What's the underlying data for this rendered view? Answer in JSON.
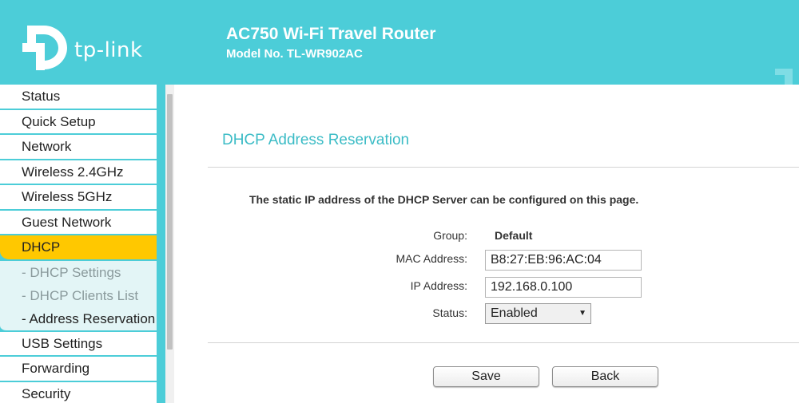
{
  "header": {
    "logo_text": "tp-link",
    "product_title": "AC750 Wi-Fi Travel Router",
    "model_no": "Model No. TL-WR902AC",
    "background": "#4ccdd8"
  },
  "sidebar": {
    "items_before": [
      {
        "label": "Status"
      },
      {
        "label": "Quick Setup"
      },
      {
        "label": "Network"
      },
      {
        "label": "Wireless 2.4GHz"
      },
      {
        "label": "Wireless 5GHz"
      },
      {
        "label": "Guest Network"
      }
    ],
    "active": {
      "label": "DHCP",
      "color": "#ffc800"
    },
    "subitems": [
      {
        "label": "- DHCP Settings"
      },
      {
        "label": "- DHCP Clients List"
      },
      {
        "label": "- Address Reservation"
      }
    ],
    "items_after": [
      {
        "label": "USB Settings"
      },
      {
        "label": "Forwarding"
      },
      {
        "label": "Security"
      }
    ]
  },
  "main": {
    "title": "DHCP Address Reservation",
    "description": "The static IP address of the DHCP Server can be configured on this page.",
    "form": {
      "group_label": "Group:",
      "group_value": "Default",
      "mac_label": "MAC Address:",
      "mac_value": "B8:27:EB:96:AC:04",
      "ip_label": "IP Address:",
      "ip_value": "192.168.0.100",
      "status_label": "Status:",
      "status_value": "Enabled"
    },
    "buttons": {
      "save": "Save",
      "back": "Back"
    }
  }
}
